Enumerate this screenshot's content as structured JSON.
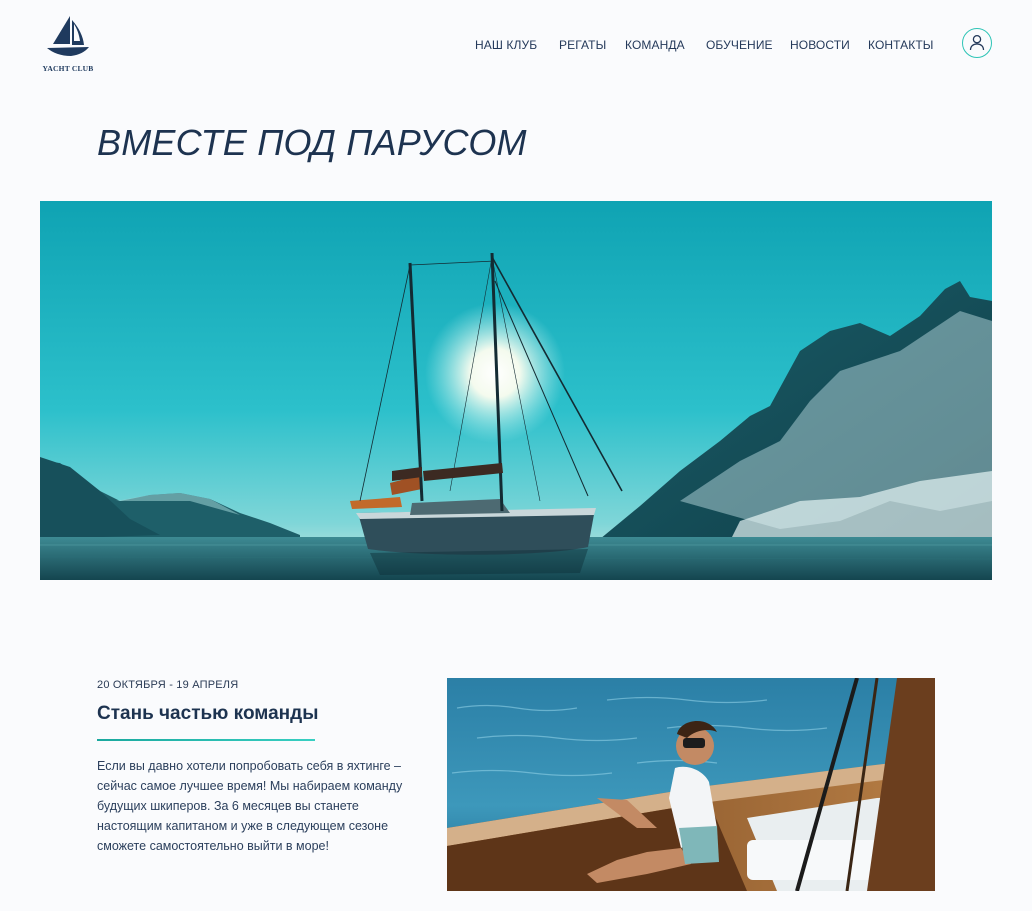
{
  "logo": {
    "text": "YACHT CLUB",
    "icon": "sailboat-icon",
    "color": "#1f3a5e"
  },
  "nav": {
    "items": [
      "НАШ КЛУБ",
      "РЕГАТЫ",
      "КОМАНДА",
      "ОБУЧЕНИЕ",
      "НОВОСТИ",
      "КОНТАКТЫ"
    ],
    "user_icon": "user-icon"
  },
  "hero": {
    "title": "ВМЕСТЕ ПОД ПАРУСОМ",
    "image": "sailboat-at-sunset-between-mountains"
  },
  "section": {
    "dates": "20 ОКТЯБРЯ - 19 АПРЕЛЯ",
    "title": "Стань частью команды",
    "text": "Если вы давно хотели попробовать себя в яхтинге – сейчас самое лучшее время! Мы набираем команду будущих шкиперов. За 6 месяцев вы станете настоящим капитаном и уже в следующем сезоне сможете самостоятельно выйти в море!",
    "image": "man-with-binoculars-on-boat"
  },
  "colors": {
    "background": "#fafbfd",
    "text": "#1d3350",
    "accent": "#2ec4b6"
  }
}
